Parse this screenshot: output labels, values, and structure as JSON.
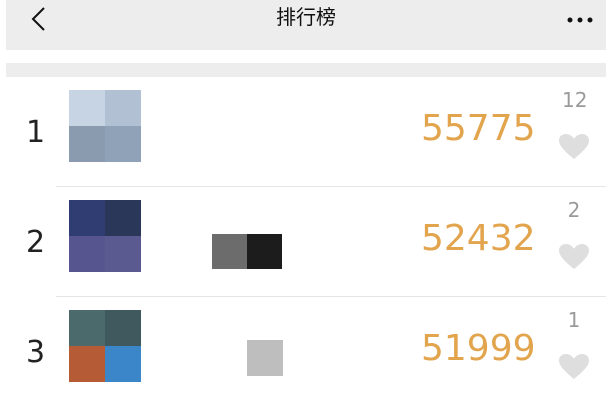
{
  "header": {
    "title": "排行榜",
    "back_icon": "chevron-left-icon",
    "more_icon": "more-dots-icon"
  },
  "ranking": [
    {
      "rank": "1",
      "steps": "55775",
      "likes": "12",
      "avatar_colors": [
        "#c6d4e3",
        "#b1c1d3",
        "#8a9bb0",
        "#8fa2b8"
      ]
    },
    {
      "rank": "2",
      "steps": "52432",
      "likes": "2",
      "avatar_colors": [
        "#2f3d72",
        "#2b3758",
        "#57558f",
        "#5a5a91"
      ]
    },
    {
      "rank": "3",
      "steps": "51999",
      "likes": "1",
      "avatar_colors": [
        "#4b6a6b",
        "#40595e",
        "#b55c36",
        "#3b86c8"
      ]
    }
  ],
  "colors": {
    "accent_steps": "#e2a54e",
    "header_bg": "#ededed",
    "like_count": "#9a9a9a",
    "heart": "#dedede"
  }
}
